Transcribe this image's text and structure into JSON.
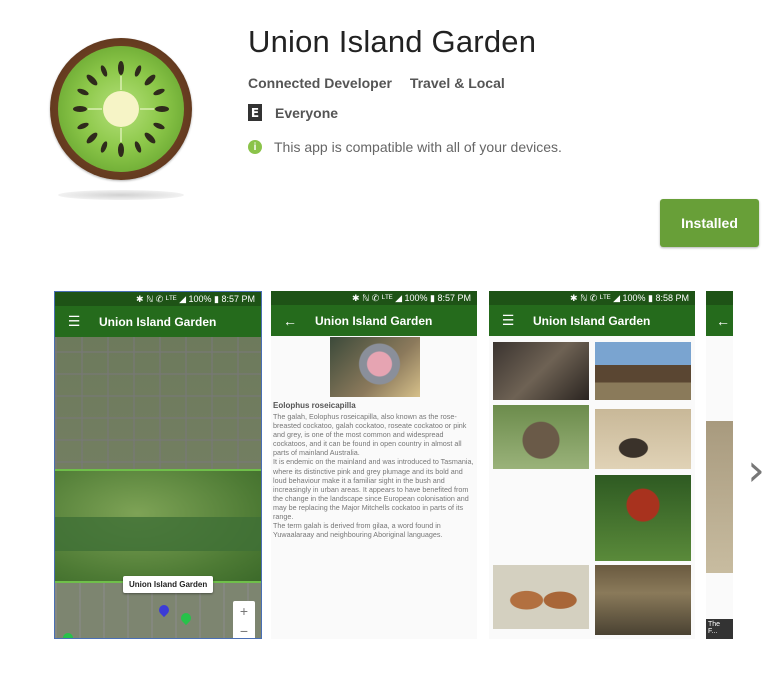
{
  "app": {
    "title": "Union Island Garden",
    "developer": "Connected Developer",
    "category": "Travel & Local",
    "content_rating": "Everyone",
    "content_rating_icon": "esrb-everyone-icon",
    "compatibility": "This app is compatible with all of your devices.",
    "install_label": "Installed",
    "accent_color": "#689f38"
  },
  "screenshots": [
    {
      "status": "✱ ℕ ✆ ᴸᵀᴱ ◢ 100% ▮ 8:57 PM",
      "toolbar_icon": "menu-icon",
      "toolbar_title": "Union Island Garden",
      "map_callout": "Union Island Garden",
      "zoom_in": "+",
      "zoom_out": "−"
    },
    {
      "status": "✱ ℕ ✆ ᴸᵀᴱ ◢ 100% ▮ 8:57 PM",
      "toolbar_icon": "back-arrow-icon",
      "toolbar_title": "Union Island Garden",
      "heading": "Eolophus roseicapilla",
      "body": "The galah, Eolophus roseicapilla, also known as the rose-breasted cockatoo, galah cockatoo, roseate cockatoo or pink and grey, is one of the most common and widespread cockatoos, and it can be found in open country in almost all parts of mainland Australia.\nIt is endemic on the mainland and was introduced to Tasmania, where its distinctive pink and grey plumage and its bold and loud behaviour make it a familiar sight in the bush and increasingly in urban areas. It appears to have benefited from the change in the landscape since European colonisation and may be replacing the Major Mitchells cockatoo in parts of its range.\nThe term galah is derived from gilaa, a word found in Yuwaalaraay and neighbouring Aboriginal languages."
    },
    {
      "status": "✱ ℕ ✆ ᴸᵀᴱ ◢ 100% ▮ 8:58 PM",
      "toolbar_icon": "menu-icon",
      "toolbar_title": "Union Island Garden"
    },
    {
      "toolbar_icon": "back-arrow-icon",
      "caption": "The F..."
    }
  ],
  "next_icon": "chevron-right-icon"
}
